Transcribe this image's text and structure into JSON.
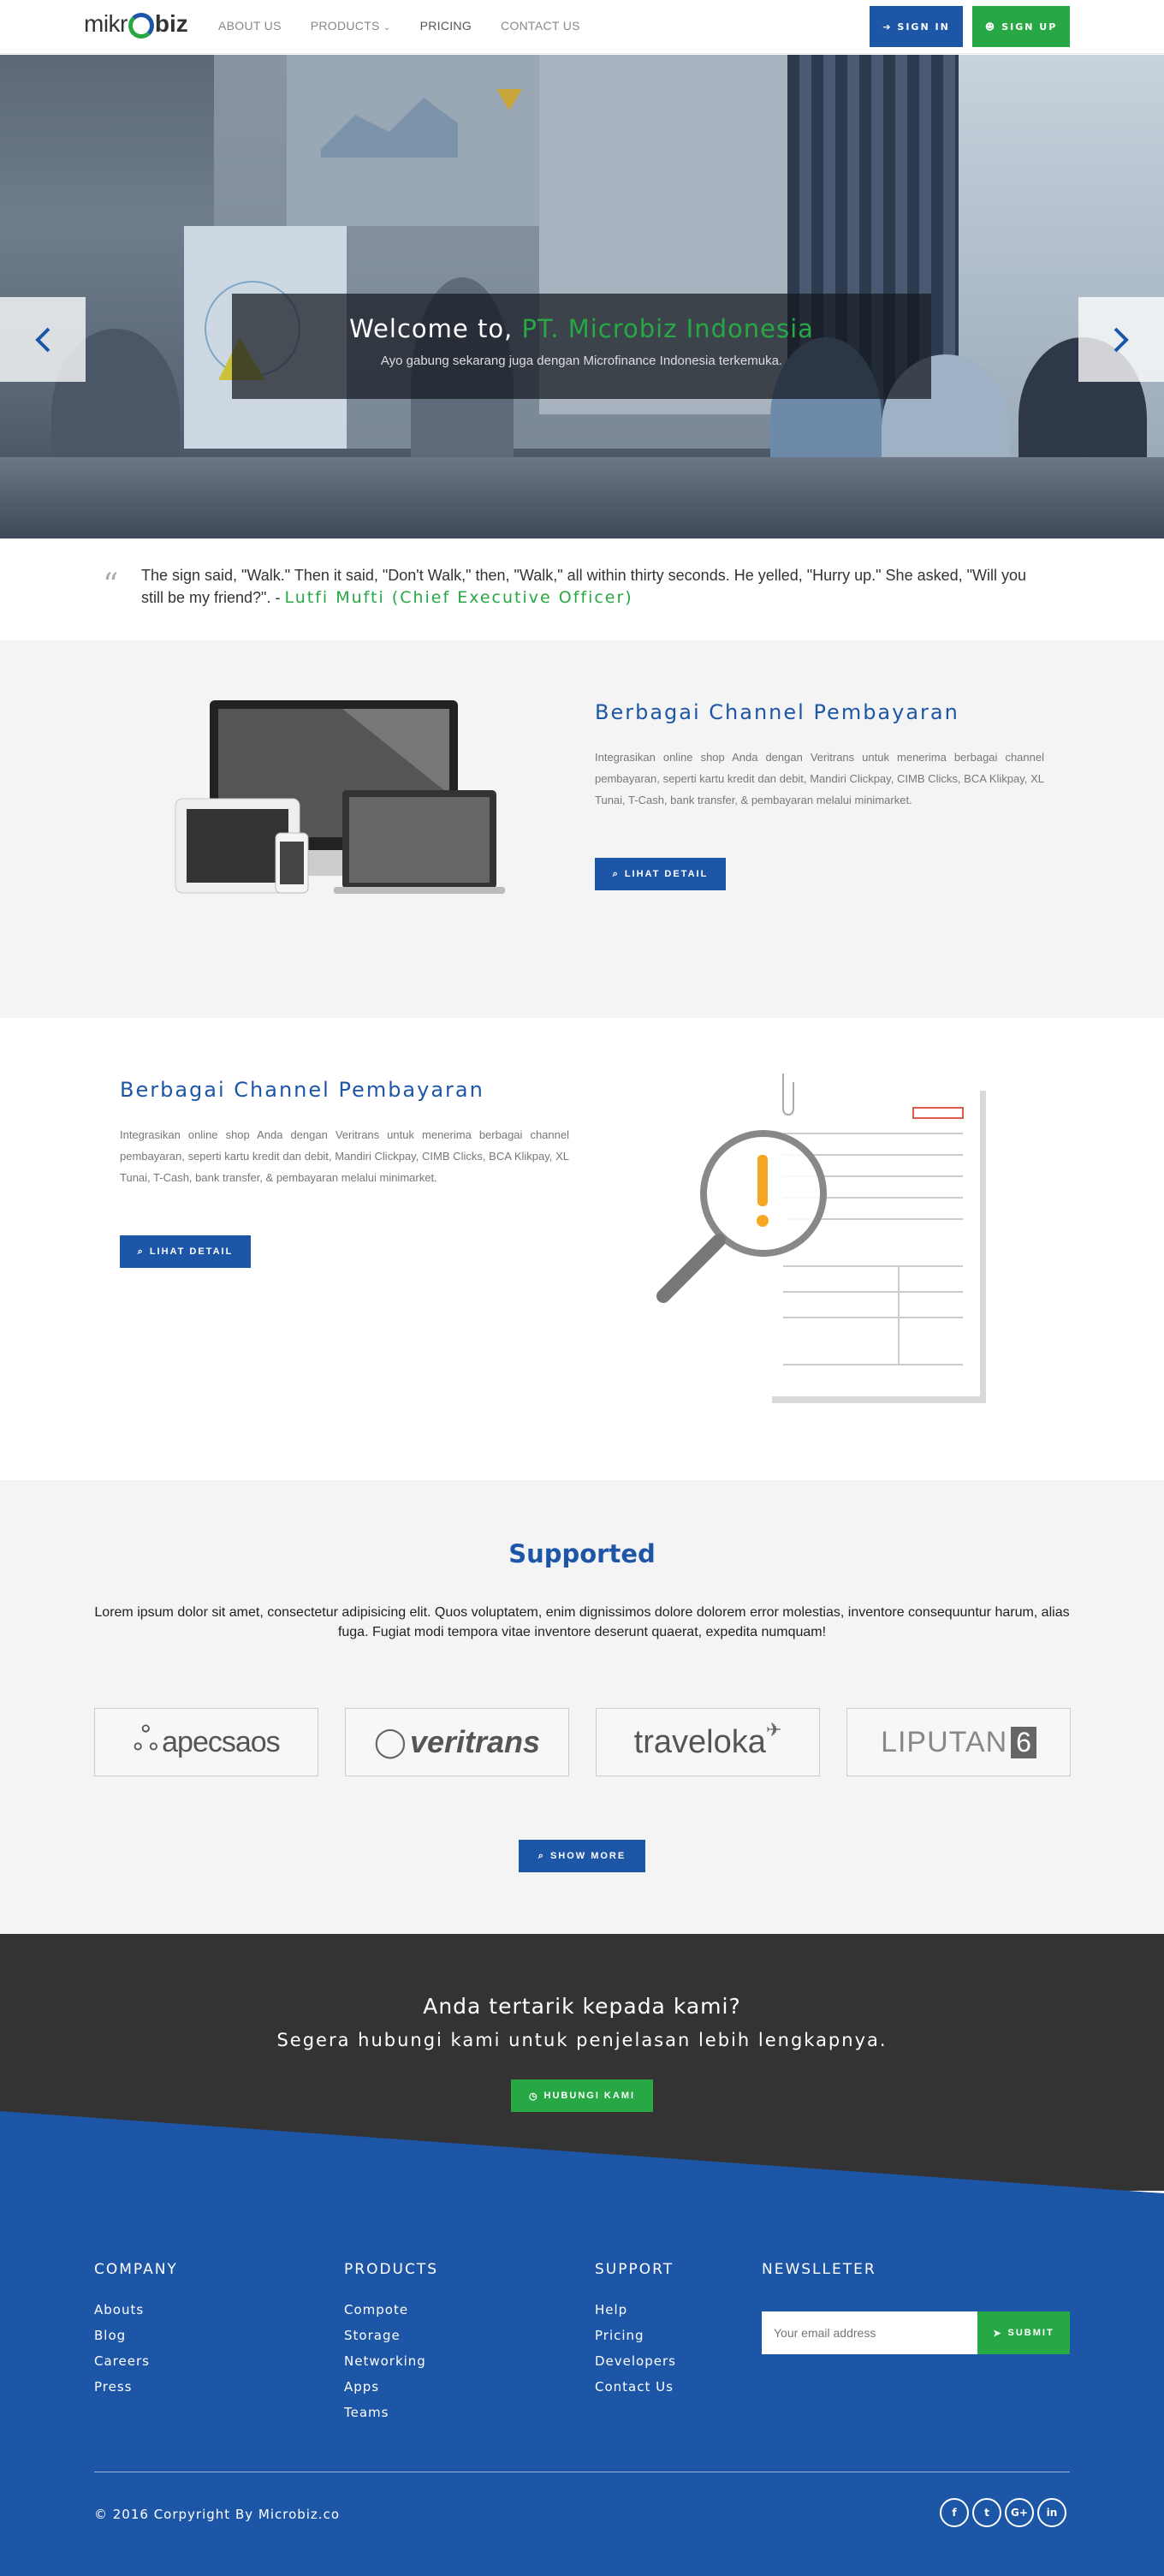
{
  "header": {
    "logo_left": "mikr",
    "logo_right": "biz",
    "nav": [
      "ABOUT US",
      "PRODUCTS",
      "PRICING",
      "CONTACT US"
    ],
    "signin": "SIGN IN",
    "signup": "SIGN UP"
  },
  "hero": {
    "title_prefix": "Welcome to,",
    "title_highlight": "PT. Microbiz Indonesia",
    "subtitle": "Ayo gabung sekarang juga dengan Microfinance Indonesia terkemuka."
  },
  "quote": {
    "text": "The sign said, \"Walk.\" Then it said, \"Don't Walk,\" then, \"Walk,\" all within thirty seconds. He yelled, \"Hurry up.\" She asked, \"Will you still be my friend?\". -",
    "author": "Lutfi Mufti (Chief Executive Officer)"
  },
  "features": [
    {
      "title": "Berbagai Channel Pembayaran",
      "text": "Integrasikan online shop Anda dengan Veritrans untuk menerima berbagai channel pembayaran, seperti kartu kredit dan debit, Mandiri Clickpay, CIMB Clicks, BCA Klikpay, XL Tunai, T-Cash, bank transfer, & pembayaran melalui minimarket.",
      "button": "LIHAT DETAIL"
    },
    {
      "title": "Berbagai Channel Pembayaran",
      "text": "Integrasikan online shop Anda dengan Veritrans untuk menerima berbagai channel pembayaran, seperti kartu kredit dan debit, Mandiri Clickpay, CIMB Clicks, BCA Klikpay, XL Tunai, T-Cash, bank transfer, & pembayaran melalui minimarket.",
      "button": "LIHAT DETAIL"
    }
  ],
  "supported": {
    "title": "Supported",
    "text": "Lorem ipsum dolor sit amet, consectetur adipisicing elit. Quos voluptatem, enim dignissimos dolore dolorem error molestias, inventore consequuntur harum, alias fuga. Fugiat modi tempora vitae inventore deserunt quaerat, expedita numquam!",
    "partners": [
      "apecsaos",
      "veritrans",
      "traveloka",
      "LIPUTAN"
    ],
    "partner_suffix": "6",
    "button": "SHOW MORE"
  },
  "cta": {
    "title": "Anda tertarik kepada kami?",
    "subtitle": "Segera hubungi kami untuk penjelasan lebih lengkapnya.",
    "button": "HUBUNGI KAMI"
  },
  "footer": {
    "company": {
      "title": "COMPANY",
      "links": [
        "Abouts",
        "Blog",
        "Careers",
        "Press"
      ]
    },
    "products": {
      "title": "PRODUCTS",
      "links": [
        "Compote",
        "Storage",
        "Networking",
        "Apps",
        "Teams"
      ]
    },
    "support": {
      "title": "SUPPORT",
      "links": [
        "Help",
        "Pricing",
        "Developers",
        "Contact Us"
      ]
    },
    "newsletter": {
      "title": "NEWSLLETER",
      "placeholder": "Your email address",
      "button": "SUBMIT"
    },
    "copyright": "© 2016 Corpyright By Microbiz.co",
    "socials": [
      "f",
      "t",
      "G+",
      "in"
    ]
  },
  "colors": {
    "brand_blue": "#1e56a7",
    "brand_green": "#27a844",
    "dark": "#333333"
  }
}
